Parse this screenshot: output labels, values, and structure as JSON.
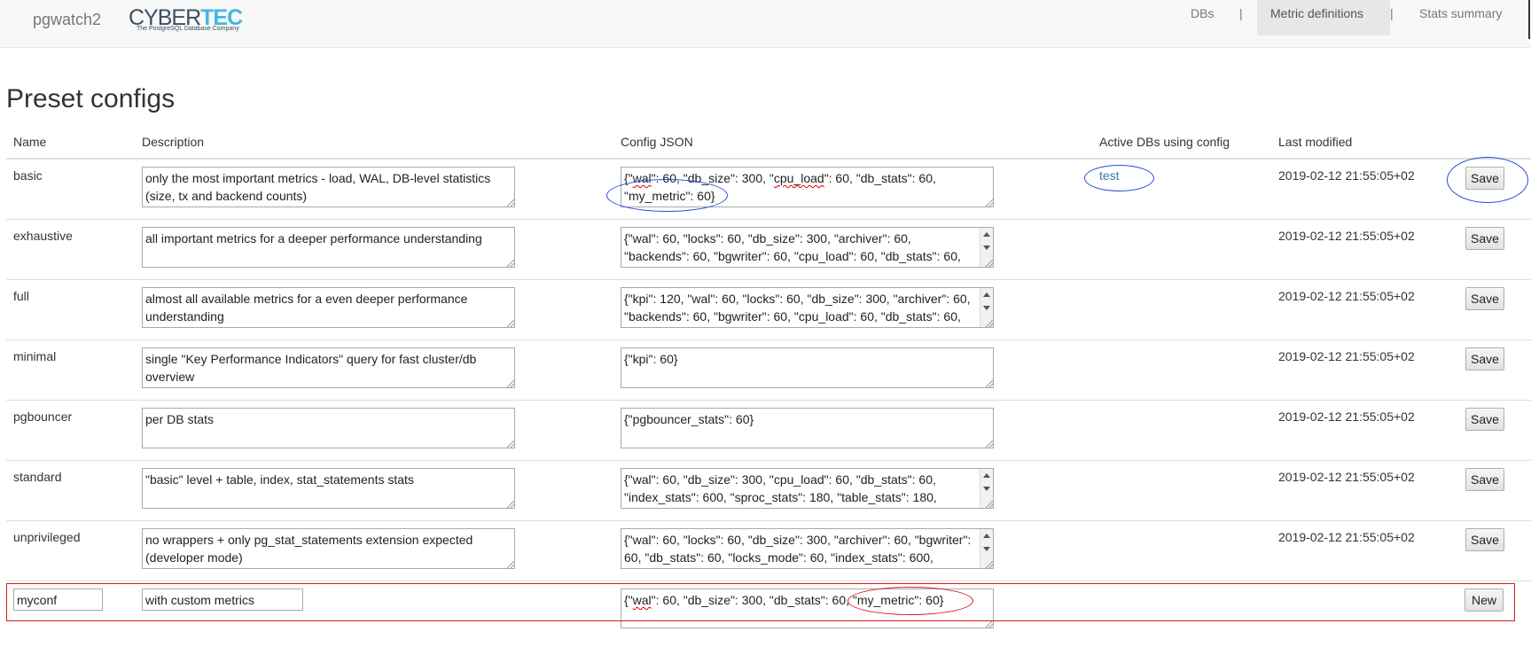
{
  "app": {
    "brand": "pgwatch2",
    "logo": {
      "part1": "CYBER",
      "part2": "TEC",
      "tagline": "The PostgreSQL Database Company"
    }
  },
  "nav": {
    "items": [
      {
        "label": "DBs",
        "active": false
      },
      {
        "label": "Metric definitions",
        "active": true
      },
      {
        "label": "Stats summary",
        "active": false
      }
    ],
    "separator": "|"
  },
  "page": {
    "title": "Preset configs"
  },
  "table": {
    "columns": [
      "Name",
      "Description",
      "Config JSON",
      "Active DBs using config",
      "Last modified"
    ],
    "rows": [
      {
        "name": "basic",
        "description": "only the most important metrics - load, WAL, DB-level statistics (size, tx and backend counts)",
        "config_pre": "{\"",
        "config_w": "wal",
        "config_mid": "\": 60, \"db_size\": 300, \"",
        "config_w2": "cpu_load",
        "config_post": "\": 60, \"db_stats\": 60, \"my_metric\": 60}",
        "active_dbs": "test",
        "modified": "2019-02-12 21:55:05+02",
        "button": "Save"
      },
      {
        "name": "exhaustive",
        "description": "all important metrics for a deeper performance understanding",
        "config": "{\"wal\": 60, \"locks\": 60, \"db_size\": 300, \"archiver\": 60, \"backends\": 60, \"bgwriter\": 60, \"cpu_load\": 60, \"db_stats\": 60,",
        "active_dbs": "",
        "modified": "2019-02-12 21:55:05+02",
        "button": "Save"
      },
      {
        "name": "full",
        "description": "almost all available metrics for a even deeper performance understanding",
        "config": "{\"kpi\": 120, \"wal\": 60, \"locks\": 60, \"db_size\": 300, \"archiver\": 60, \"backends\": 60, \"bgwriter\": 60, \"cpu_load\": 60, \"db_stats\": 60,",
        "active_dbs": "",
        "modified": "2019-02-12 21:55:05+02",
        "button": "Save"
      },
      {
        "name": "minimal",
        "description": "single \"Key Performance Indicators\" query for fast cluster/db overview",
        "config": "{\"kpi\": 60}",
        "active_dbs": "",
        "modified": "2019-02-12 21:55:05+02",
        "button": "Save"
      },
      {
        "name": "pgbouncer",
        "description": "per DB stats",
        "config": "{\"pgbouncer_stats\": 60}",
        "active_dbs": "",
        "modified": "2019-02-12 21:55:05+02",
        "button": "Save"
      },
      {
        "name": "standard",
        "description": "\"basic\" level + table, index, stat_statements stats",
        "config": "{\"wal\": 60, \"db_size\": 300, \"cpu_load\": 60, \"db_stats\": 60, \"index_stats\": 600, \"sproc_stats\": 180, \"table_stats\": 180,",
        "active_dbs": "",
        "modified": "2019-02-12 21:55:05+02",
        "button": "Save"
      },
      {
        "name": "unprivileged",
        "description": "no wrappers + only pg_stat_statements extension expected (developer mode)",
        "config": "{\"wal\": 60, \"locks\": 60, \"db_size\": 300, \"archiver\": 60, \"bgwriter\": 60, \"db_stats\": 60, \"locks_mode\": 60, \"index_stats\": 600,",
        "active_dbs": "",
        "modified": "2019-02-12 21:55:05+02",
        "button": "Save"
      }
    ],
    "new_row": {
      "name_value": "myconf",
      "description_value": "with custom metrics",
      "config_pre": "{\"",
      "config_w": "wal",
      "config_post": "\": 60, \"db_size\": 300, \"db_stats\": 60, \"my_metric\": 60}",
      "button": "New"
    }
  },
  "colors": {
    "annotation_blue": "#2a4bd7",
    "annotation_red": "#d51a1a",
    "link": "#337ab7"
  }
}
